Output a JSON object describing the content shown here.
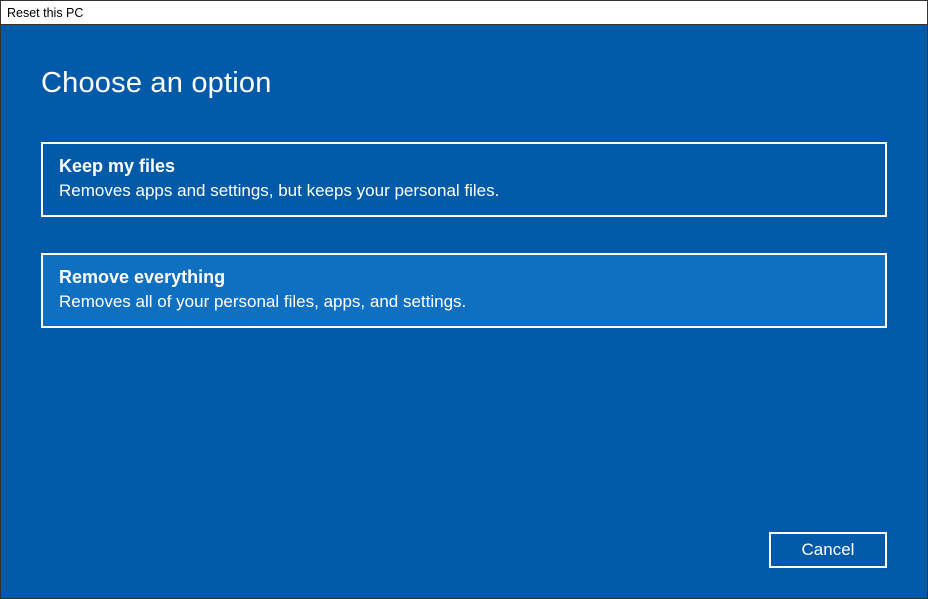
{
  "window": {
    "title": "Reset this PC"
  },
  "heading": "Choose an option",
  "options": [
    {
      "title": "Keep my files",
      "desc": "Removes apps and settings, but keeps your personal files.",
      "selected": false
    },
    {
      "title": "Remove everything",
      "desc": "Removes all of your personal files, apps, and settings.",
      "selected": true
    }
  ],
  "footer": {
    "cancel_label": "Cancel"
  }
}
